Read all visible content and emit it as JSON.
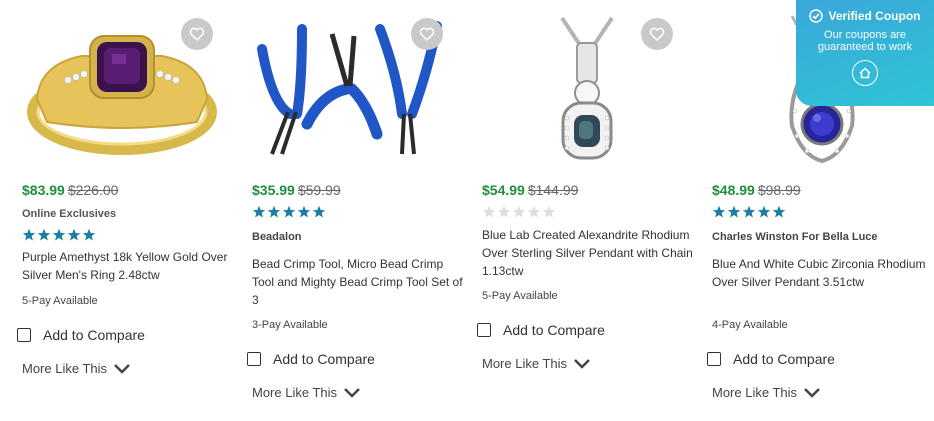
{
  "products": [
    {
      "sale_price": "$83.99",
      "was_price": "$226.00",
      "brand": "Online Exclusives",
      "rating": 5,
      "title": "Purple Amethyst 18k Yellow Gold Over Silver Men's Ring 2.48ctw",
      "pay": "5-Pay Available",
      "compare_label": "Add to Compare",
      "more_label": "More Like This"
    },
    {
      "sale_price": "$35.99",
      "was_price": "$59.99",
      "brand": "Beadalon",
      "rating": 5,
      "title": "Bead Crimp Tool, Micro Bead Crimp Tool and Mighty Bead Crimp Tool Set of 3",
      "pay": "3-Pay Available",
      "compare_label": "Add to Compare",
      "more_label": "More Like This"
    },
    {
      "sale_price": "$54.99",
      "was_price": "$144.99",
      "brand": "",
      "rating": 0,
      "title": "Blue Lab Created Alexandrite Rhodium Over Sterling Silver Pendant with Chain 1.13ctw",
      "pay": "5-Pay Available",
      "compare_label": "Add to Compare",
      "more_label": "More Like This"
    },
    {
      "sale_price": "$48.99",
      "was_price": "$98.99",
      "brand": "Charles Winston For Bella Luce",
      "rating": 5,
      "title": "Blue And White Cubic Zirconia Rhodium Over Silver Pendant 3.51ctw",
      "pay": "4-Pay Available",
      "compare_label": "Add to Compare",
      "more_label": "More Like This"
    }
  ],
  "coupon": {
    "title": "Verified Coupon",
    "subtitle": "Our coupons are guaranteed to work"
  },
  "colors": {
    "sale_green": "#1e8f3a",
    "star_teal": "#1a7fa3",
    "star_empty": "#dddddd",
    "coupon_bg": "#2fb3d8"
  }
}
